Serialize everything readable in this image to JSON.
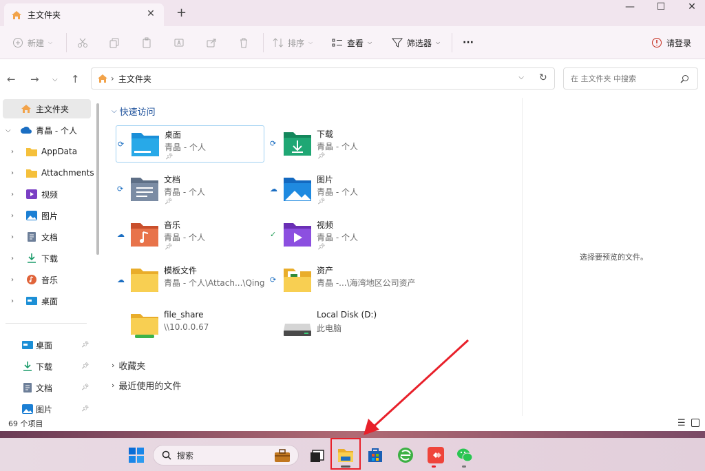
{
  "window": {
    "tab_title": "主文件夹",
    "close": "✕",
    "newtab": "+",
    "minimize": "—",
    "maximize": "☐",
    "close_window": "✕"
  },
  "toolbar": {
    "new": "新建",
    "sort": "排序",
    "view": "查看",
    "filter": "筛选器",
    "more": "···",
    "login": "请登录"
  },
  "address": {
    "path": "主文件夹",
    "search_placeholder": "在 主文件夹 中搜索"
  },
  "sidebar": {
    "items": [
      {
        "label": "主文件夹",
        "type": "home"
      },
      {
        "label": "青晶 - 个人",
        "type": "cloud"
      },
      {
        "label": "AppData",
        "type": "folder"
      },
      {
        "label": "Attachments",
        "type": "folder"
      },
      {
        "label": "视频",
        "type": "video"
      },
      {
        "label": "图片",
        "type": "pictures"
      },
      {
        "label": "文档",
        "type": "docs"
      },
      {
        "label": "下载",
        "type": "download"
      },
      {
        "label": "音乐",
        "type": "music"
      },
      {
        "label": "桌面",
        "type": "desktop"
      }
    ],
    "pinned": [
      {
        "label": "桌面"
      },
      {
        "label": "下载"
      },
      {
        "label": "文档"
      },
      {
        "label": "图片"
      }
    ]
  },
  "content": {
    "quick_access": "快速访问",
    "favorites": "收藏夹",
    "recent": "最近使用的文件",
    "cards": [
      {
        "name": "桌面",
        "sub": "青晶 - 个人",
        "status": "sync"
      },
      {
        "name": "下载",
        "sub": "青晶 - 个人",
        "status": "sync"
      },
      {
        "name": "文档",
        "sub": "青晶 - 个人",
        "status": "sync"
      },
      {
        "name": "图片",
        "sub": "青晶 - 个人",
        "status": "cloud"
      },
      {
        "name": "音乐",
        "sub": "青晶 - 个人",
        "status": "cloud"
      },
      {
        "name": "视频",
        "sub": "青晶 - 个人",
        "status": "ok"
      },
      {
        "name": "模板文件",
        "sub": "青晶 - 个人\\Attach...\\Qing",
        "status": "cloud"
      },
      {
        "name": "资产",
        "sub": "青晶 -...\\海湾地区公司资产",
        "status": "sync"
      },
      {
        "name": "file_share",
        "sub": "\\\\10.0.0.67",
        "status": ""
      },
      {
        "name": "Local Disk (D:)",
        "sub": "此电脑",
        "status": ""
      }
    ]
  },
  "preview": {
    "text": "选择要预览的文件。"
  },
  "status": {
    "count": "69 个项目"
  },
  "taskbar": {
    "search": "搜索"
  },
  "colors": {
    "highlight": "#e8202a",
    "accent": "#1b6ec2"
  }
}
